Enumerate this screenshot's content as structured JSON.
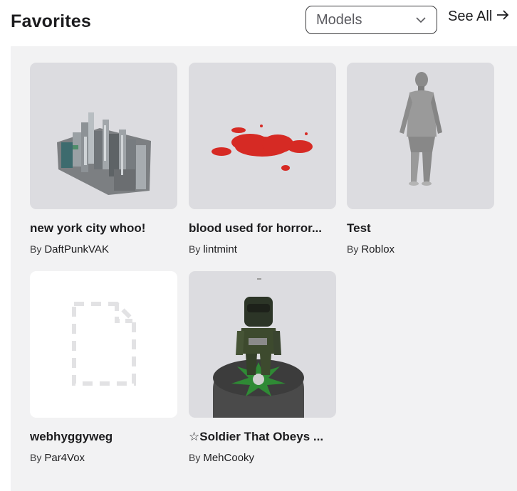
{
  "header": {
    "title": "Favorites",
    "filter_selected": "Models",
    "see_all_label": "See All"
  },
  "items": [
    {
      "name": "new york city whoo!",
      "by": "By",
      "creator": "DaftPunkVAK",
      "thumbnail": "city-model"
    },
    {
      "name": "blood used for horror...",
      "by": "By",
      "creator": "lintmint",
      "thumbnail": "blood-splatter"
    },
    {
      "name": "Test",
      "by": "By",
      "creator": "Roblox",
      "thumbnail": "gray-mannequin"
    },
    {
      "name": "webhyggyweg",
      "by": "By",
      "creator": "Par4Vox",
      "thumbnail": "placeholder-file-icon"
    },
    {
      "name": "☆Soldier That Obeys ...",
      "by": "By",
      "creator": "MehCooky",
      "thumbnail": "soldier-on-pedestal"
    }
  ],
  "colors": {
    "panel_bg": "#f2f2f3",
    "thumb_bg": "#dcdce0",
    "text": "#1c1c1e"
  }
}
